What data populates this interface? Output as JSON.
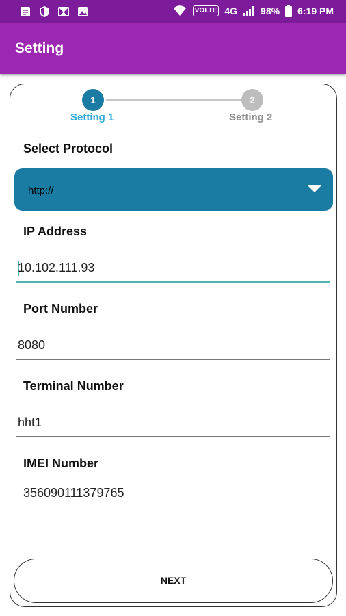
{
  "status_bar": {
    "network_label": "VOLTE",
    "network_type": "4G",
    "battery": "98%",
    "time": "6:19 PM",
    "icons": [
      "message-icon",
      "shield-icon",
      "gallery-icon",
      "image-icon",
      "wifi-icon",
      "signal-icon",
      "battery-icon"
    ]
  },
  "app_bar": {
    "title": "Setting"
  },
  "stepper": {
    "steps": [
      {
        "number": "1",
        "label": "Setting 1",
        "active": true
      },
      {
        "number": "2",
        "label": "Setting 2",
        "active": false
      }
    ]
  },
  "form": {
    "protocol": {
      "label": "Select Protocol",
      "selected": "http://"
    },
    "ip_address": {
      "label": "IP Address",
      "value": "10.102.111.93"
    },
    "port": {
      "label": "Port Number",
      "value": "8080"
    },
    "terminal": {
      "label": "Terminal Number",
      "value": "hht1"
    },
    "imei": {
      "label": "IMEI Number",
      "value": "356090111379765"
    }
  },
  "actions": {
    "next_label": "NEXT"
  },
  "colors": {
    "status_bar": "#7c1c9a",
    "app_bar": "#9c27b0",
    "primary": "#1a7ba3",
    "active_step_label": "#2ea7d8",
    "focus_underline": "#4db6ac"
  }
}
